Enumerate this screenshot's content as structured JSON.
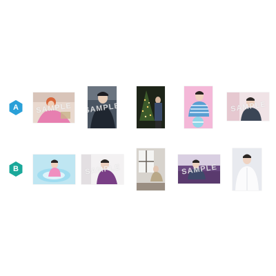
{
  "sets": [
    {
      "label": "A",
      "badge_color": "#2aa0d8",
      "photos": [
        {
          "name": "a1",
          "watermark": "SAMPLE"
        },
        {
          "name": "a2",
          "watermark": "SAMPLE"
        },
        {
          "name": "a3",
          "watermark": ""
        },
        {
          "name": "a4",
          "watermark": ""
        },
        {
          "name": "a5",
          "watermark": "SAMPLE"
        }
      ]
    },
    {
      "label": "B",
      "badge_color": "#1aa89a",
      "photos": [
        {
          "name": "b1",
          "watermark": ""
        },
        {
          "name": "b2",
          "watermark": "SAMPLE"
        },
        {
          "name": "b3",
          "watermark": ""
        },
        {
          "name": "b4",
          "watermark": "SAMPLE"
        },
        {
          "name": "b5",
          "watermark": ""
        }
      ]
    }
  ]
}
